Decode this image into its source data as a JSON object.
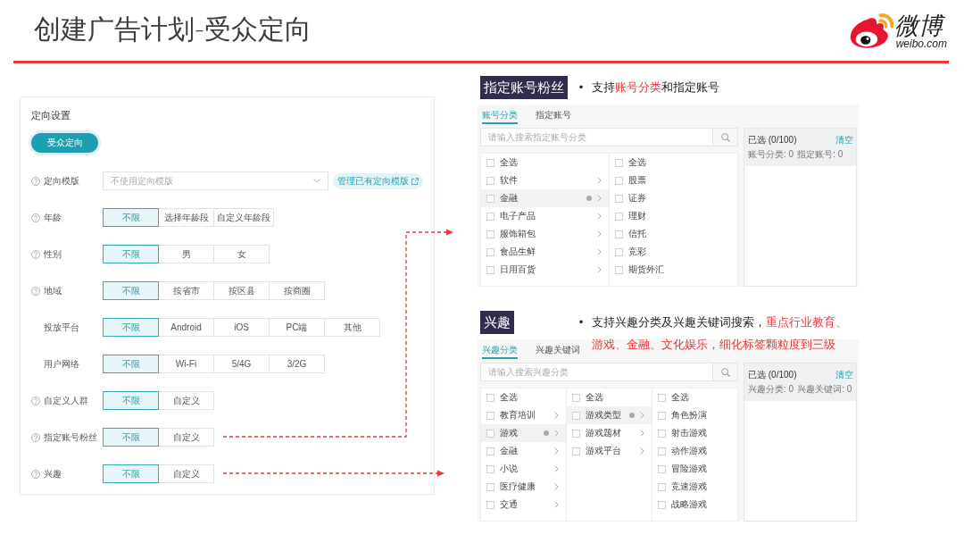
{
  "header": {
    "title": "创建广告计划-受众定向",
    "logo": {
      "name": "微博",
      "domain": "weibo.com"
    }
  },
  "form": {
    "heading": "定向设置",
    "mode_button": "受众定向",
    "template": {
      "label": "定向模版",
      "help": true,
      "placeholder": "不使用定向模版",
      "manage_link": "管理已有定向模版"
    },
    "rows": [
      {
        "label": "年龄",
        "help": true,
        "options": [
          {
            "label": "不限",
            "selected": true
          },
          {
            "label": "选择年龄段",
            "selected": false
          },
          {
            "label": "自定义年龄段",
            "selected": false
          }
        ]
      },
      {
        "label": "性别",
        "help": true,
        "options": [
          {
            "label": "不限",
            "selected": true
          },
          {
            "label": "男",
            "selected": false
          },
          {
            "label": "女",
            "selected": false
          }
        ]
      },
      {
        "label": "地域",
        "help": true,
        "options": [
          {
            "label": "不限",
            "selected": true
          },
          {
            "label": "按省市",
            "selected": false
          },
          {
            "label": "按区县",
            "selected": false
          },
          {
            "label": "按商圈",
            "selected": false
          }
        ]
      },
      {
        "label": "投放平台",
        "help": false,
        "options": [
          {
            "label": "不限",
            "selected": true
          },
          {
            "label": "Android",
            "selected": false
          },
          {
            "label": "iOS",
            "selected": false
          },
          {
            "label": "PC端",
            "selected": false
          },
          {
            "label": "其他",
            "selected": false
          }
        ]
      },
      {
        "label": "用户网络",
        "help": false,
        "options": [
          {
            "label": "不限",
            "selected": true
          },
          {
            "label": "Wi-Fi",
            "selected": false
          },
          {
            "label": "5/4G",
            "selected": false
          },
          {
            "label": "3/2G",
            "selected": false
          }
        ]
      },
      {
        "label": "自定义人群",
        "help": true,
        "options": [
          {
            "label": "不限",
            "selected": true
          },
          {
            "label": "自定义",
            "selected": false
          }
        ]
      },
      {
        "label": "指定账号粉丝",
        "help": true,
        "options": [
          {
            "label": "不限",
            "selected": true
          },
          {
            "label": "自定义",
            "selected": false
          }
        ]
      },
      {
        "label": "兴趣",
        "help": true,
        "options": [
          {
            "label": "不限",
            "selected": true
          },
          {
            "label": "自定义",
            "selected": false
          }
        ]
      }
    ]
  },
  "callouts": [
    {
      "tag": "指定账号粉丝",
      "bullet": "•",
      "text": [
        {
          "text": "支持",
          "highlight": false
        },
        {
          "text": "账号分类",
          "highlight": true
        },
        {
          "text": "和指定账号",
          "highlight": false
        }
      ],
      "panel": {
        "tabs": [
          {
            "label": "账号分类",
            "selected": true
          },
          {
            "label": "指定账号",
            "selected": false
          }
        ],
        "search": {
          "placeholder": "请输入搜索指定账号分类"
        },
        "columns": [
          [
            {
              "label": "全选",
              "checked": false,
              "expanded": false,
              "has_children": false
            },
            {
              "label": "软件",
              "checked": false,
              "expanded": false,
              "has_children": true
            },
            {
              "label": "金融",
              "checked": false,
              "expanded": true,
              "has_children": true
            },
            {
              "label": "电子产品",
              "checked": false,
              "expanded": false,
              "has_children": true
            },
            {
              "label": "服饰箱包",
              "checked": false,
              "expanded": false,
              "has_children": true
            },
            {
              "label": "食品生鲜",
              "checked": false,
              "expanded": false,
              "has_children": true
            },
            {
              "label": "日用百货",
              "checked": false,
              "expanded": false,
              "has_children": true
            }
          ],
          [
            {
              "label": "全选",
              "checked": false,
              "expanded": false,
              "has_children": false
            },
            {
              "label": "股票",
              "checked": false,
              "expanded": false,
              "has_children": false
            },
            {
              "label": "证券",
              "checked": false,
              "expanded": false,
              "has_children": false
            },
            {
              "label": "理财",
              "checked": false,
              "expanded": false,
              "has_children": false
            },
            {
              "label": "信托",
              "checked": false,
              "expanded": false,
              "has_children": false
            },
            {
              "label": "竞彩",
              "checked": false,
              "expanded": false,
              "has_children": false
            },
            {
              "label": "期货外汇",
              "checked": false,
              "expanded": false,
              "has_children": false
            }
          ]
        ],
        "summary": {
          "title": "已选 (0/100)",
          "clear": "清空",
          "counts": [
            "账号分类: 0",
            "指定账号: 0"
          ]
        }
      }
    },
    {
      "tag": "兴趣",
      "bullet": "•",
      "text": [
        {
          "text": "支持兴趣分类及兴趣关键词搜索，",
          "highlight": false
        },
        {
          "text": "重点行业教育、游戏、金融、文化娱乐，细化标签颗粒度到三级",
          "highlight": true
        }
      ],
      "panel": {
        "tabs": [
          {
            "label": "兴趣分类",
            "selected": true
          },
          {
            "label": "兴趣关键词",
            "selected": false
          }
        ],
        "search": {
          "placeholder": "请输入搜索兴趣分类"
        },
        "columns": [
          [
            {
              "label": "全选",
              "checked": false,
              "expanded": false,
              "has_children": false
            },
            {
              "label": "教育培训",
              "checked": false,
              "expanded": false,
              "has_children": true
            },
            {
              "label": "游戏",
              "checked": false,
              "expanded": true,
              "has_children": true
            },
            {
              "label": "金融",
              "checked": false,
              "expanded": false,
              "has_children": true
            },
            {
              "label": "小说",
              "checked": false,
              "expanded": false,
              "has_children": true
            },
            {
              "label": "医疗健康",
              "checked": false,
              "expanded": false,
              "has_children": true
            },
            {
              "label": "交通",
              "checked": false,
              "expanded": false,
              "has_children": true
            }
          ],
          [
            {
              "label": "全选",
              "checked": false,
              "expanded": false,
              "has_children": false
            },
            {
              "label": "游戏类型",
              "checked": false,
              "expanded": true,
              "has_children": true
            },
            {
              "label": "游戏题材",
              "checked": false,
              "expanded": false,
              "has_children": true
            },
            {
              "label": "游戏平台",
              "checked": false,
              "expanded": false,
              "has_children": true
            }
          ],
          [
            {
              "label": "全选",
              "checked": false,
              "expanded": false,
              "has_children": false
            },
            {
              "label": "角色扮演",
              "checked": false,
              "expanded": false,
              "has_children": false
            },
            {
              "label": "射击游戏",
              "checked": false,
              "expanded": false,
              "has_children": false
            },
            {
              "label": "动作游戏",
              "checked": false,
              "expanded": false,
              "has_children": false
            },
            {
              "label": "冒险游戏",
              "checked": false,
              "expanded": false,
              "has_children": false
            },
            {
              "label": "竞速游戏",
              "checked": false,
              "expanded": false,
              "has_children": false
            },
            {
              "label": "战略游戏",
              "checked": false,
              "expanded": false,
              "has_children": false
            }
          ]
        ],
        "summary": {
          "title": "已选 (0/100)",
          "clear": "清空",
          "counts": [
            "兴趣分类: 0",
            "兴趣关键词: 0"
          ]
        }
      }
    }
  ]
}
